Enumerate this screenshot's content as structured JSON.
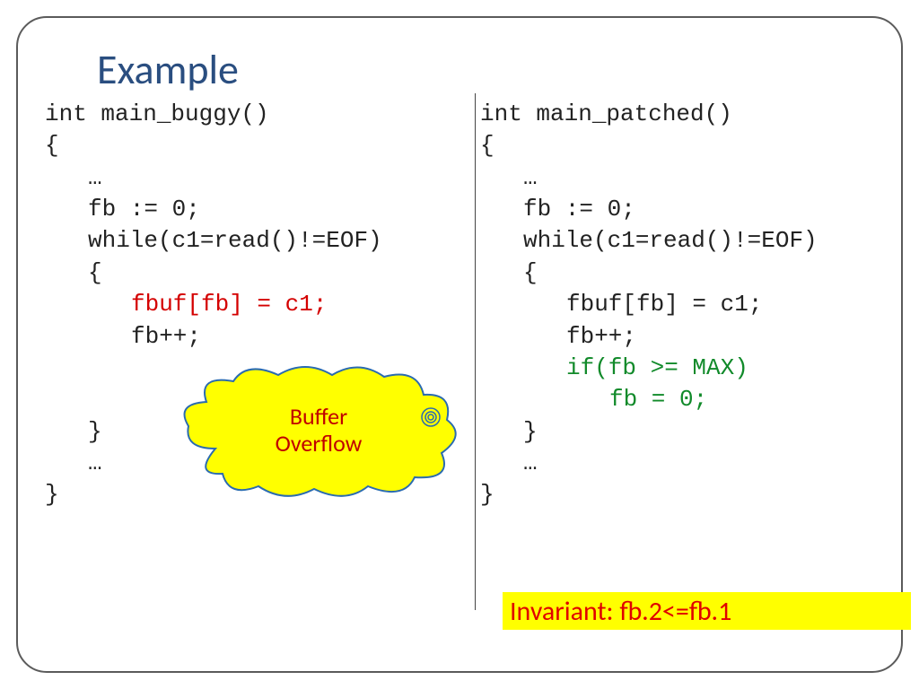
{
  "title": "Example",
  "left": {
    "l1": "int main_buggy()",
    "l2": "{",
    "l3": "…",
    "l4": "fb := 0;",
    "l5": "while(c1=read()!=EOF)",
    "l6": "{",
    "l7": "fbuf[fb] = c1;",
    "l8": "fb++;",
    "l9": "}",
    "l10": "…",
    "l11": "}"
  },
  "right": {
    "l1": "int main_patched()",
    "l2": "{",
    "l3": "…",
    "l4": "fb := 0;",
    "l5": "while(c1=read()!=EOF)",
    "l6": "{",
    "l7": "fbuf[fb] = c1;",
    "l8": "fb++;",
    "l9": "if(fb >= MAX)",
    "l10": "fb = 0;",
    "l11": "}",
    "l12": "…",
    "l13": "}"
  },
  "cloud": {
    "line1": "Buffer",
    "line2": "Overflow"
  },
  "invariant": "Invariant: fb.2<=fb.1"
}
